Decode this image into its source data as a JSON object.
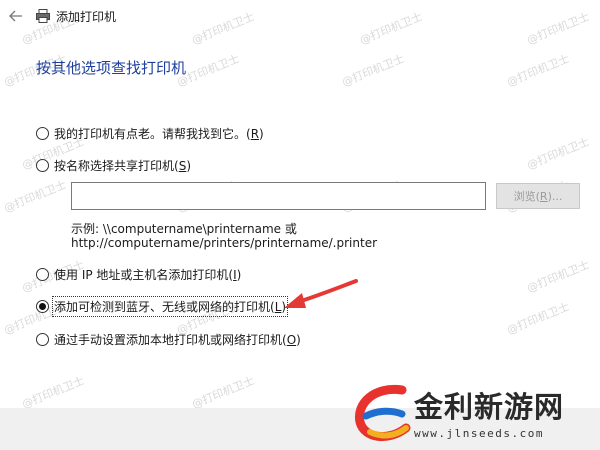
{
  "window": {
    "title": "添加打印机",
    "back_icon": "back-arrow-icon",
    "printer_icon": "printer-icon"
  },
  "heading": "按其他选项查找打印机",
  "options": [
    {
      "label": "我的打印机有点老。请帮我找到它。",
      "mnemonic": "R",
      "checked": false
    },
    {
      "label": "按名称选择共享打印机",
      "mnemonic": "S",
      "checked": false
    },
    {
      "label": "使用 IP 地址或主机名添加打印机",
      "mnemonic": "I",
      "checked": false
    },
    {
      "label": "添加可检测到蓝牙、无线或网络的打印机",
      "mnemonic": "L",
      "checked": true
    },
    {
      "label": "通过手动设置添加本地打印机或网络打印机",
      "mnemonic": "O",
      "checked": false
    }
  ],
  "share": {
    "input_value": "",
    "browse_label": "浏览",
    "browse_mnemonic": "R",
    "browse_suffix": "...",
    "example_line1": "示例: \\\\computername\\printername 或",
    "example_line2": "http://computername/printers/printername/.printer"
  },
  "watermark": "@打印机卫士",
  "logo": {
    "name": "金利新游网",
    "url": "www.jlnseeds.com",
    "colors": {
      "red": "#e8322e",
      "blue": "#1f6fd1",
      "yellow": "#f2b01e"
    }
  },
  "colors": {
    "heading": "#1f3f9e",
    "arrow": "#e53935"
  }
}
